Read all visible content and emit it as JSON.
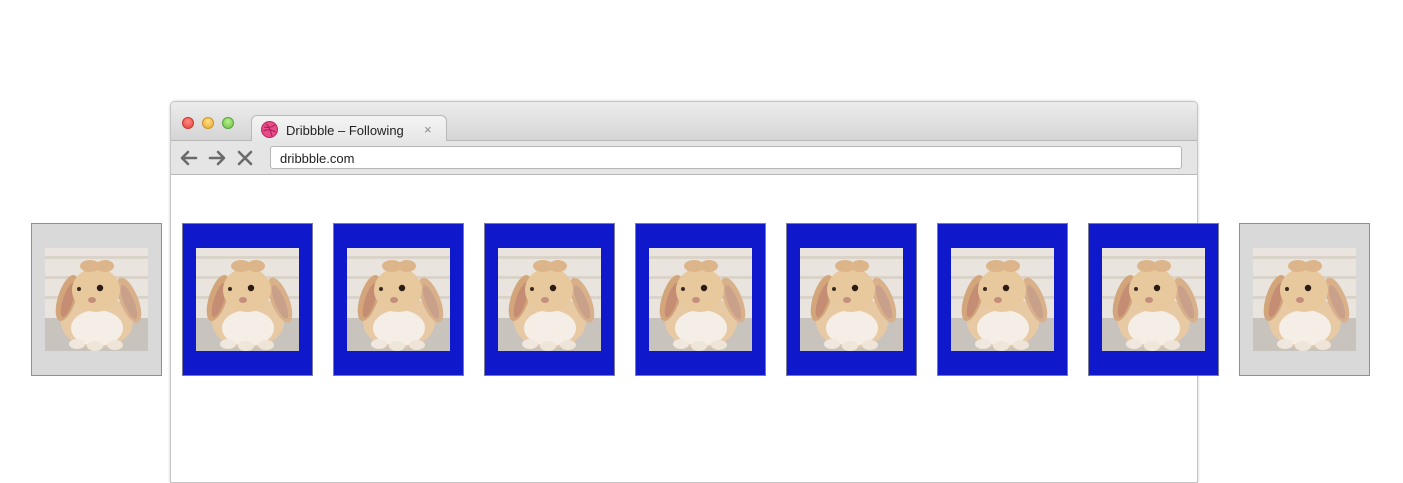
{
  "window": {
    "controls": [
      "close",
      "minimize",
      "zoom"
    ]
  },
  "tab": {
    "title": "Dribbble – Following",
    "close_glyph": "×",
    "favicon": "dribbble-icon"
  },
  "toolbar": {
    "back_icon": "arrow-left-icon",
    "forward_icon": "arrow-right-icon",
    "stop_icon": "close-icon",
    "address": "dribbble.com"
  },
  "carousel": {
    "active_color": "#1018cc",
    "inactive_color": "#d9d9d9",
    "items": [
      {
        "image": "bunny-photo",
        "state": "inactive"
      },
      {
        "image": "bunny-photo",
        "state": "active"
      },
      {
        "image": "bunny-photo",
        "state": "active"
      },
      {
        "image": "bunny-photo",
        "state": "active"
      },
      {
        "image": "bunny-photo",
        "state": "active"
      },
      {
        "image": "bunny-photo",
        "state": "active"
      },
      {
        "image": "bunny-photo",
        "state": "active"
      },
      {
        "image": "bunny-photo",
        "state": "active"
      },
      {
        "image": "bunny-photo",
        "state": "inactive"
      }
    ]
  }
}
